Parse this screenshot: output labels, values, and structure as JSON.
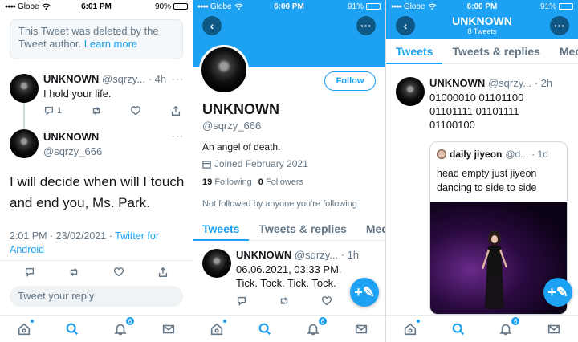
{
  "status": {
    "carrier": "Globe",
    "panel1": {
      "time": "6:01 PM",
      "battery": "90%",
      "battery_level": 0.9
    },
    "panel2": {
      "time": "6:00 PM",
      "battery": "91%",
      "battery_level": 0.91
    },
    "panel3": {
      "time": "6:00 PM",
      "battery": "91%",
      "battery_level": 0.91
    }
  },
  "thread": {
    "deleted_notice": "This Tweet was deleted by the Tweet author.",
    "deleted_link": "Learn more",
    "reply": {
      "name": "UNKNOWN",
      "handle": "@sqrzy...",
      "time": "· 4h",
      "text": "I hold your life.",
      "reply_count": "1"
    },
    "main": {
      "name": "UNKNOWN",
      "handle": "@sqrzy_666",
      "text": "I will decide when will I touch and end you, Ms. Park.",
      "timestamp": "2:01 PM · 23/02/2021 ·",
      "source": "Twitter for Android"
    },
    "reply_placeholder": "Tweet your reply"
  },
  "profile": {
    "follow_label": "Follow",
    "name": "UNKNOWN",
    "handle": "@sqrzy_666",
    "bio": "An angel of death.",
    "joined": "Joined February 2021",
    "following_count": "19",
    "following_label": "Following",
    "followers_count": "0",
    "followers_label": "Followers",
    "not_followed": "Not followed by anyone you're following",
    "tabs": [
      "Tweets",
      "Tweets & replies",
      "Media"
    ],
    "tweet": {
      "name": "UNKNOWN",
      "handle": "@sqrzy...",
      "time": "· 1h",
      "text": "06.06.2021, 03:33 PM. Tick. Tock. Tick. Tock."
    }
  },
  "timeline": {
    "title": "UNKNOWN",
    "subtitle": "8 Tweets",
    "tabs": [
      "Tweets",
      "Tweets & replies",
      "Media"
    ],
    "tweet": {
      "name": "UNKNOWN",
      "handle": "@sqrzy...",
      "time": "· 2h",
      "text": "01000010 01101100 01101111 01101111 01100100"
    },
    "quote": {
      "name": "daily jiyeon",
      "handle": "@d...",
      "time": "· 1d",
      "text": "head empty just jiyeon dancing to side to side"
    }
  },
  "nav": {
    "notifications_badge": "6",
    "icons": [
      "home-icon",
      "search-icon",
      "bell-icon",
      "mail-icon"
    ]
  },
  "colors": {
    "accent": "#1da1f2",
    "muted": "#657786",
    "text": "#14171a"
  }
}
